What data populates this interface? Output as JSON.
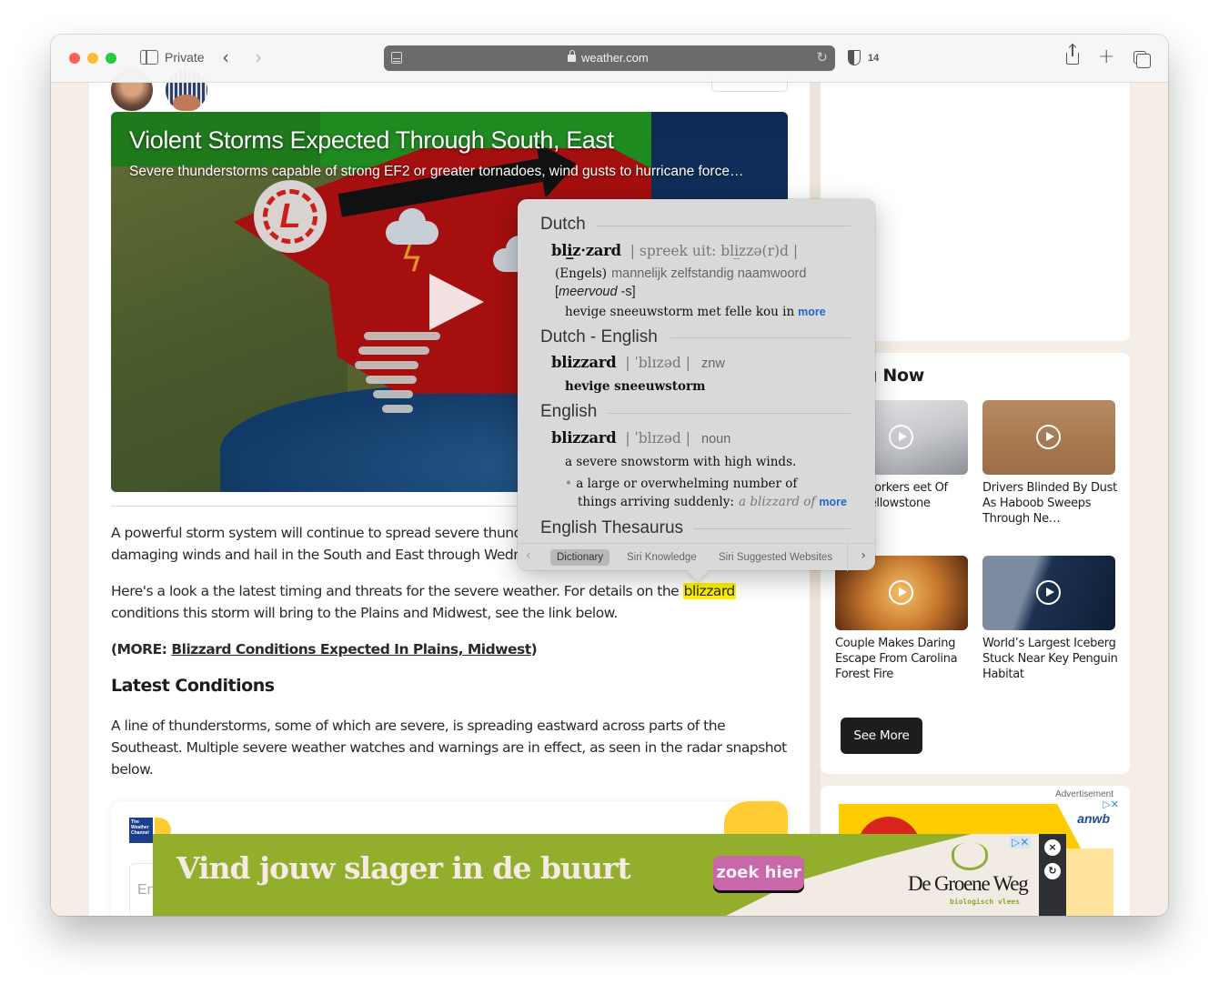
{
  "browser": {
    "mode_label": "Private",
    "url": "weather.com",
    "tracker_count": "14"
  },
  "video": {
    "title": "Violent Storms Expected Through South, East",
    "subtitle": "Severe thunderstorms capable of strong EF2 or greater tornadoes, wind gusts to hurricane force…",
    "map_low_label": "L"
  },
  "article": {
    "p1_line1": "A powerful storm system will continue to spread severe thunderstorms with tornadoes,",
    "p1_line2": "damaging winds and hail in the South and East through Wednesday.",
    "p2_before": "Here's a look a the latest timing and threats for the severe weather. For details on the ",
    "p2_highlight": "blizzard",
    "p2_after": " conditions this storm will bring to the Plains and Midwest, see the link below.",
    "more_prefix": "(MORE: ",
    "more_link": "Blizzard Conditions Expected In Plains, Midwest",
    "more_suffix": ")",
    "heading": "Latest Conditions",
    "p4": "A line of thunderstorms, some of which are severe, is spreading eastward across parts of the Southeast. Multiple severe weather watches and warnings are in effect, as seen in the radar snapshot below.",
    "embed_logo": "The Weather Channel",
    "embed_input_placeholder": "En"
  },
  "dictionary_popover": {
    "sections": [
      {
        "heading": "Dutch",
        "headword": "bli̲z·zard",
        "pronunciation": "| spreek uit: bli̲zzə(r)d |",
        "origin": "(Engels)",
        "part_of_speech": "mannelijk zelfstandig naamwoord",
        "plural_label": "meervoud",
        "plural_suffix": " -s",
        "definition": "hevige sneeuwstorm met felle kou in",
        "more": "more"
      },
      {
        "heading": "Dutch - English",
        "headword": "blizzard",
        "pronunciation": "| ˈblɪzəd |",
        "part_of_speech": "znw",
        "definition": "hevige sneeuwstorm"
      },
      {
        "heading": "English",
        "headword": "blizzard",
        "pronunciation": "| ˈblɪzəd |",
        "part_of_speech": "noun",
        "definition_1": "a severe snowstorm with high winds.",
        "definition_2_line1": "a large or overwhelming number of",
        "definition_2_line2": "things arriving suddenly:",
        "example": "a blizzard of",
        "more": "more"
      },
      {
        "heading": "English Thesaurus"
      }
    ],
    "tabs": [
      {
        "label": "Dictionary",
        "active": true
      },
      {
        "label": "Siri Knowledge",
        "active": false
      },
      {
        "label": "Siri Suggested Websites",
        "active": false
      }
    ]
  },
  "sidebar": {
    "trending_title": "ding Now",
    "videos": [
      {
        "caption": " How Workers eet Of Snow ellowstone"
      },
      {
        "caption": "Drivers Blinded By Dust As Haboob Sweeps Through Ne…"
      },
      {
        "caption": "Couple Makes Daring Escape From Carolina Forest Fire"
      },
      {
        "caption": "World’s Largest Iceberg Stuck Near Key Penguin Habitat"
      }
    ],
    "see_more": "See More",
    "ad_label": "Advertisement",
    "ad_brand": "anwb"
  },
  "banner_ad": {
    "headline": "Vind jouw slager in de buurt",
    "cta": "zoek hier",
    "brand": "De Groene Weg",
    "tagline": "biologisch vlees",
    "adchoices": "▷✕",
    "close": "×",
    "refresh": "↻"
  }
}
